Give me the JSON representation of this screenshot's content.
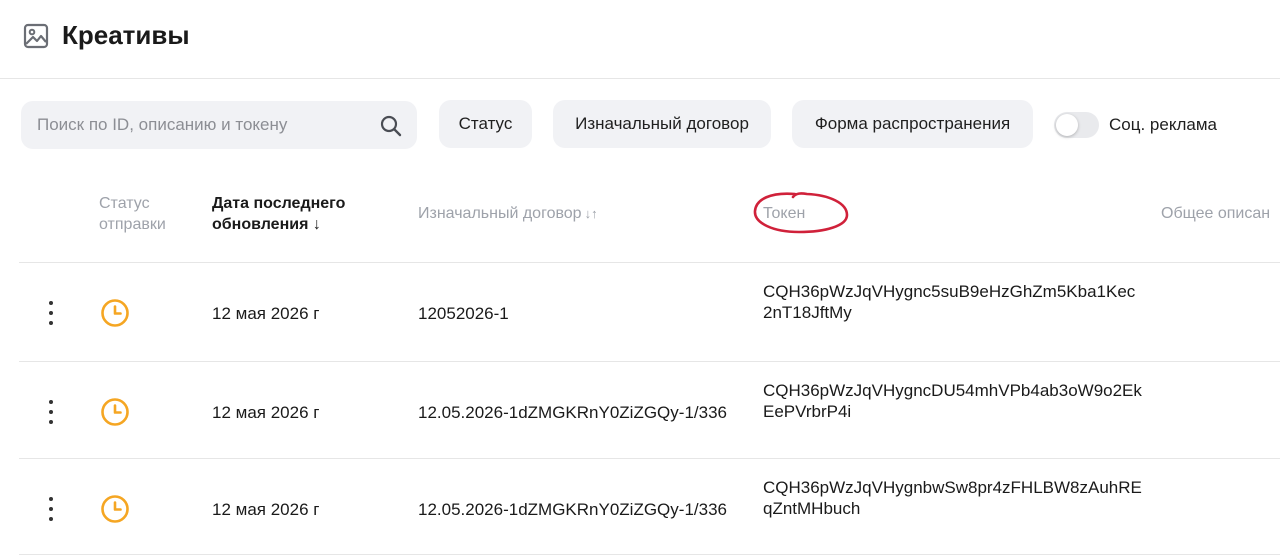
{
  "header": {
    "title": "Креативы",
    "icon": "image-icon"
  },
  "filters": {
    "search_placeholder": "Поиск по ID, описанию и токену",
    "search_value": "",
    "status_label": "Статус",
    "contract_label": "Изначальный договор",
    "form_label": "Форма распространения",
    "social_ad_label": "Соц. реклама",
    "social_ad_enabled": false
  },
  "table": {
    "columns": {
      "status": "Статус отправки",
      "date": "Дата последнего обновления ↓",
      "contract": "Изначальный договор",
      "contract_sort": "↓↑",
      "token": "Токен",
      "description": "Общее описан"
    },
    "rows": [
      {
        "status_icon": "clock-icon",
        "date": "12 мая 2026 г",
        "contract": "12052026-1",
        "token": "CQH36pWzJqVHygnc5suB9eHzGhZm5Kba1Kec2nT18JftMy"
      },
      {
        "status_icon": "clock-icon",
        "date": "12 мая 2026 г",
        "contract": "12.05.2026-1dZMGKRnY0ZiZGQy-1/336",
        "token": "CQH36pWzJqVHygncDU54mhVPb4ab3oW9o2EkEePVrbrP4i"
      },
      {
        "status_icon": "clock-icon",
        "date": "12 мая 2026 г",
        "contract": "12.05.2026-1dZMGKRnY0ZiZGQy-1/336",
        "token": "CQH36pWzJqVHygnbwSw8pr4zFHLBW8zAuhREqZntMHbuch"
      }
    ]
  },
  "colors": {
    "accent_clock": "#f5a623",
    "annotation_circle": "#d0213a",
    "muted_text": "#9ea2aa",
    "control_bg": "#f1f2f5"
  }
}
